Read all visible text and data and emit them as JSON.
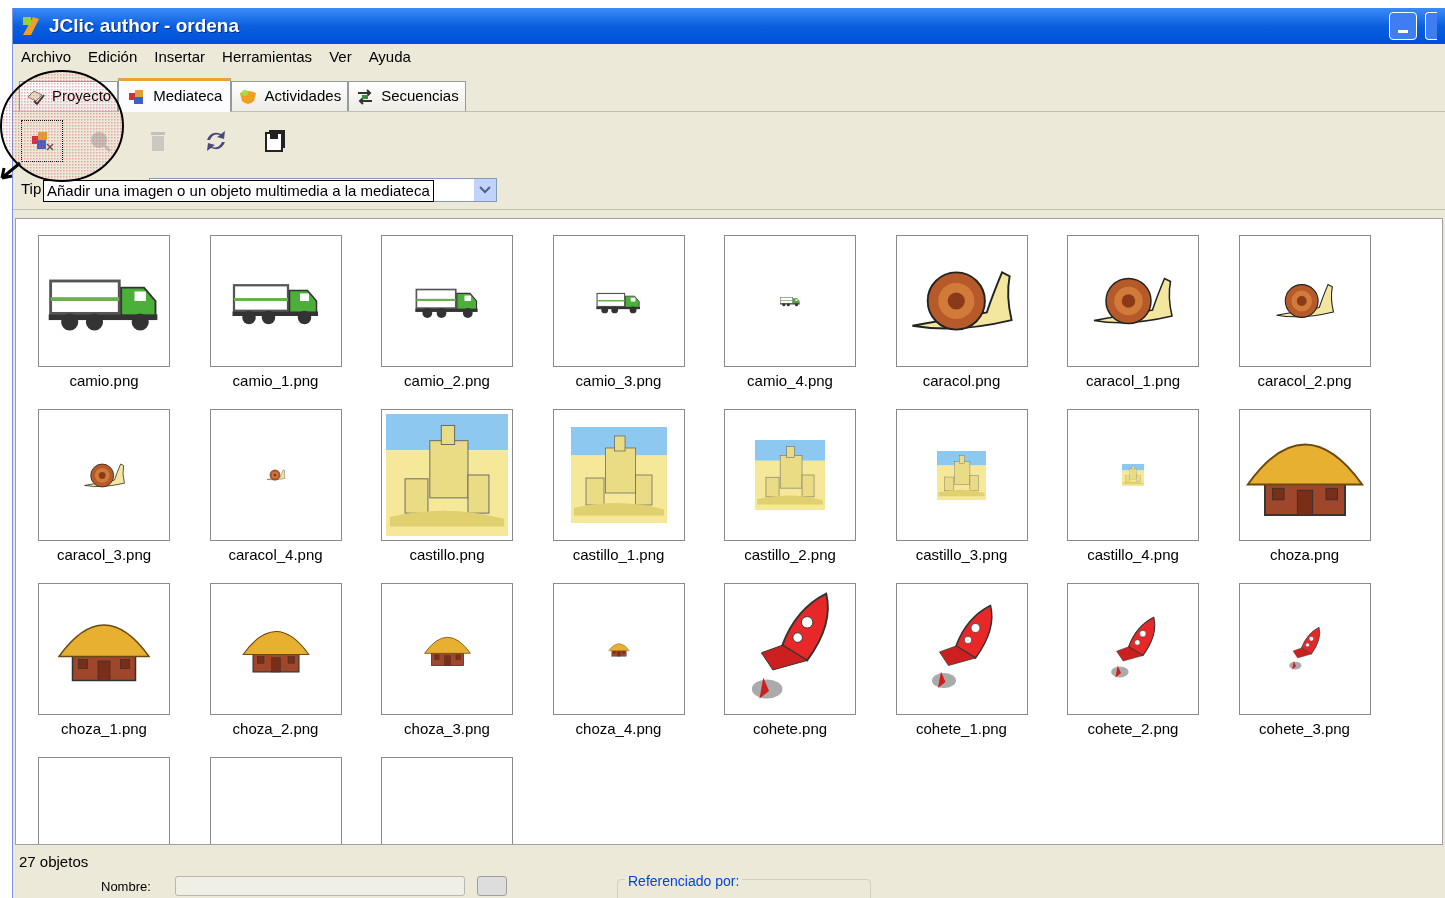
{
  "window": {
    "title": "JClic author - ordena"
  },
  "menu": [
    "Archivo",
    "Edición",
    "Insertar",
    "Herramientas",
    "Ver",
    "Ayuda"
  ],
  "tabs": [
    {
      "label": "Proyecto",
      "kind": "project",
      "selected": false
    },
    {
      "label": "Mediateca",
      "kind": "media",
      "selected": true
    },
    {
      "label": "Actividades",
      "kind": "activities",
      "selected": false
    },
    {
      "label": "Secuencias",
      "kind": "sequences",
      "selected": false
    }
  ],
  "toolbar": [
    {
      "kind": "add",
      "disabled": false,
      "focused": true
    },
    {
      "kind": "preview",
      "disabled": true,
      "focused": false
    },
    {
      "kind": "delete",
      "disabled": true,
      "focused": false
    },
    {
      "kind": "refresh",
      "disabled": false,
      "focused": false
    },
    {
      "kind": "save",
      "disabled": false,
      "focused": false
    }
  ],
  "filter": {
    "label": "Tip"
  },
  "tooltip": {
    "text": "Añadir una imagen o un objeto multimedia a la mediateca"
  },
  "media": [
    {
      "label": "camio.png",
      "kind": "picture"
    },
    {
      "label": "camio_1.png",
      "kind": "picture"
    },
    {
      "label": "camio_2.png",
      "kind": "picture"
    },
    {
      "label": "camio_3.png",
      "kind": "picture"
    },
    {
      "label": "camio_4.png",
      "kind": "picture"
    },
    {
      "label": "caracol.png",
      "kind": "picture"
    },
    {
      "label": "caracol_1.png",
      "kind": "picture"
    },
    {
      "label": "caracol_2.png",
      "kind": "picture"
    },
    {
      "label": "caracol_3.png",
      "kind": "picture"
    },
    {
      "label": "caracol_4.png",
      "kind": "picture"
    },
    {
      "label": "castillo.png",
      "kind": "picture"
    },
    {
      "label": "castillo_1.png",
      "kind": "picture"
    },
    {
      "label": "castillo_2.png",
      "kind": "picture"
    },
    {
      "label": "castillo_3.png",
      "kind": "picture"
    },
    {
      "label": "castillo_4.png",
      "kind": "picture"
    },
    {
      "label": "choza.png",
      "kind": "picture"
    },
    {
      "label": "choza_1.png",
      "kind": "picture"
    },
    {
      "label": "choza_2.png",
      "kind": "picture"
    },
    {
      "label": "choza_3.png",
      "kind": "picture"
    },
    {
      "label": "choza_4.png",
      "kind": "picture"
    },
    {
      "label": "cohete.png",
      "kind": "picture"
    },
    {
      "label": "cohete_1.png",
      "kind": "picture"
    },
    {
      "label": "cohete_2.png",
      "kind": "picture"
    },
    {
      "label": "cohete_3.png",
      "kind": "picture"
    },
    {
      "kind": "frame"
    },
    {
      "kind": "frame"
    },
    {
      "kind": "frame"
    }
  ],
  "status": "27 objetos",
  "details": {
    "name_label": "Nombre:",
    "references_label": "Referenciado por:"
  }
}
